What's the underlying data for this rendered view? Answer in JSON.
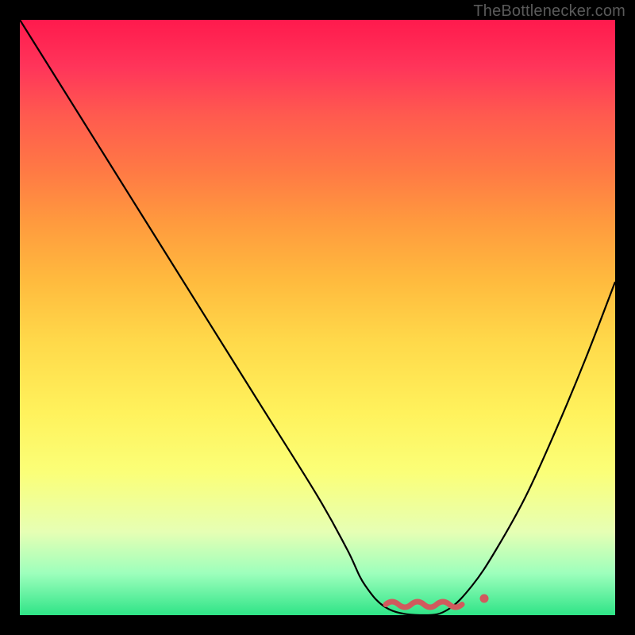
{
  "watermark": "TheBottlenecker.com",
  "chart_data": {
    "type": "line",
    "title": "",
    "xlabel": "",
    "ylabel": "",
    "xlim": [
      0,
      100
    ],
    "ylim": [
      0,
      100
    ],
    "background_gradient": {
      "top_color": "#ff1a4d",
      "bottom_color": "#2fe487",
      "description": "red-to-green vertical gradient (high=bad, low=good)"
    },
    "series": [
      {
        "name": "bottleneck-curve",
        "x": [
          0,
          10,
          20,
          30,
          40,
          50,
          55,
          58,
          62,
          68,
          72,
          76,
          80,
          85,
          90,
          95,
          100
        ],
        "y": [
          100,
          84,
          68,
          52,
          36,
          20,
          11,
          5,
          1,
          0,
          1,
          5,
          11,
          20,
          31,
          43,
          56
        ]
      }
    ],
    "annotations": {
      "optimal_range_x": [
        62,
        78
      ],
      "marker_x": 79,
      "marker_y": 3
    }
  }
}
